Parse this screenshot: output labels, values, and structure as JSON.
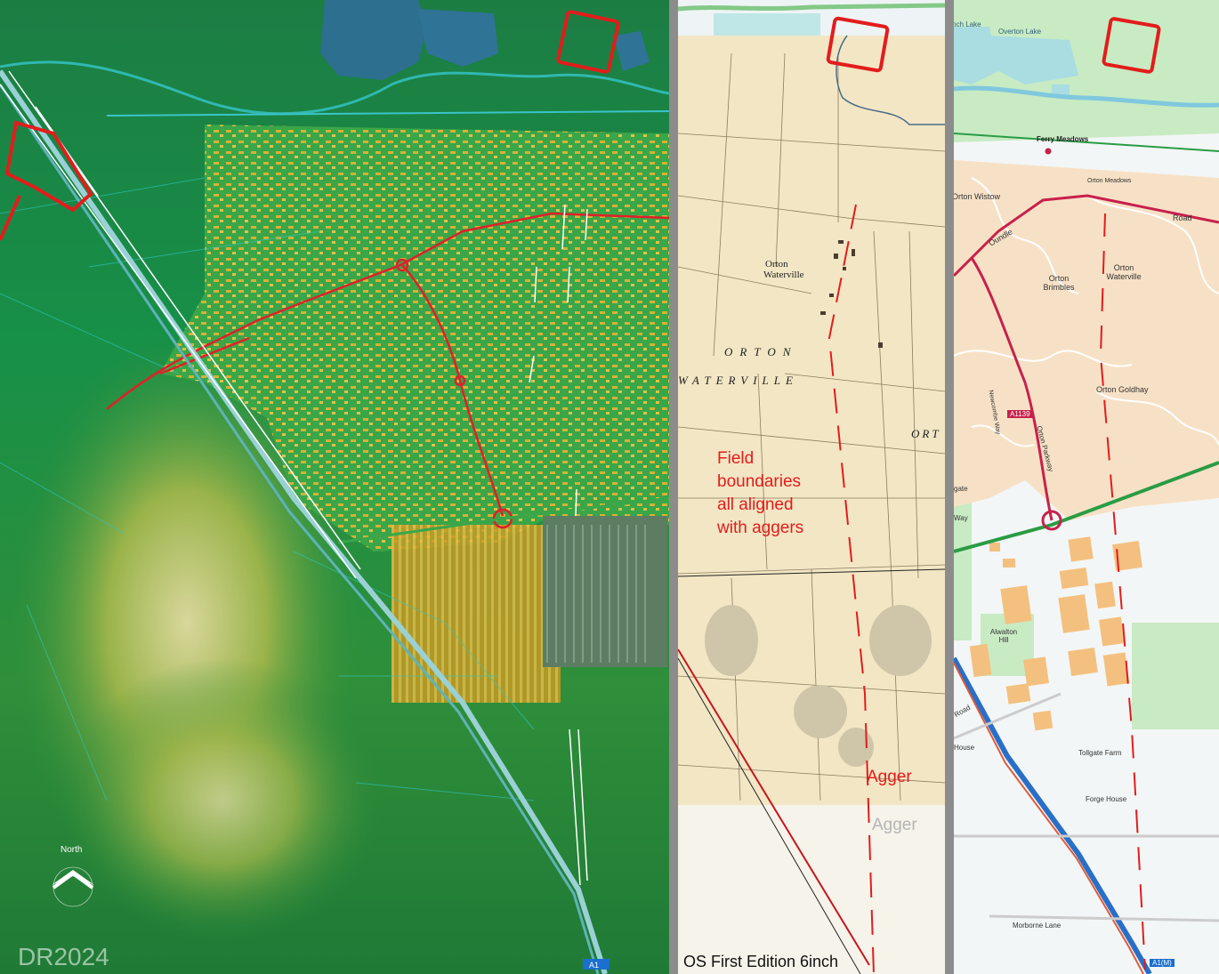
{
  "lidar_panel": {
    "north_label": "North",
    "credit": "DR2024",
    "bottom_badge": "A1"
  },
  "old_map_panel": {
    "caption": "OS First Edition 6inch",
    "place_names": [
      "Orton",
      "Waterville",
      "ORTON",
      "WATERVILLE",
      "ORT"
    ],
    "annotation_lines": [
      "Field",
      "boundaries",
      "all aligned",
      "with aggers"
    ],
    "agger_label_red": "Agger",
    "agger_label_grey": "Agger",
    "annotation_color": "#e31c1c"
  },
  "modern_map_panel": {
    "labels": {
      "lynch_lake": "Lynch Lake",
      "overton_lake": "Overton Lake",
      "ferry_meadows": "Ferry Meadows",
      "orton_meadows": "Orton Meadows",
      "orton_wistow": "Orton Wistow",
      "oundle": "Oundle",
      "road": "Road",
      "orton_brimbles": "Orton Brimbles",
      "orton_waterville": "Orton Waterville",
      "orton_goldhay": "Orton Goldhay",
      "a1139": "A1139",
      "orton_parkway": "Orton Parkway",
      "newcombe_way": "Newcombe Way",
      "alwalton_hill": "Alwalton Hill",
      "tollgate_farm": "Tollgate Farm",
      "forge_house": "Forge House",
      "morborne_lane": "Morborne Lane",
      "a1m": "A1(M)",
      "gate": "gate",
      "way": "Way",
      "house": "House",
      "road_w": "Road"
    }
  },
  "colors": {
    "annotation_red": "#e31c1c",
    "lidar_green": "#1f8a3a",
    "old_map_paper": "#f2e6c4",
    "modern_building": "#f4c07f"
  }
}
